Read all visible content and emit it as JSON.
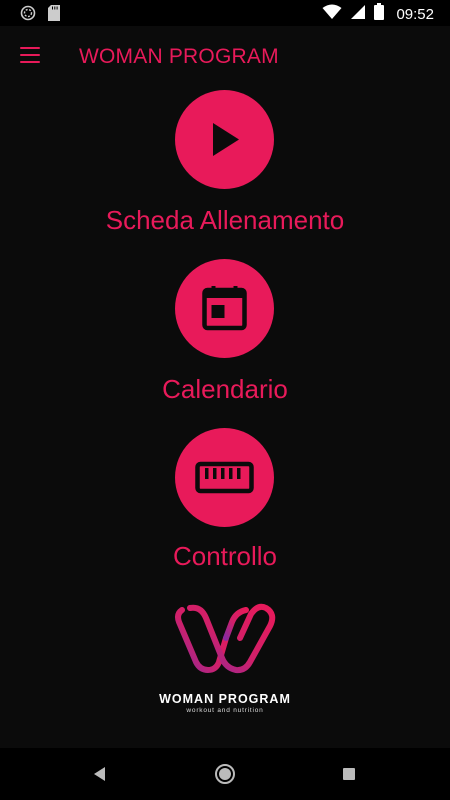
{
  "status_bar": {
    "time": "09:52",
    "icons": [
      "notification-icon",
      "sd-card-icon",
      "wifi-icon",
      "signal-icon",
      "battery-icon"
    ]
  },
  "app_bar": {
    "title": "WOMAN PROGRAM",
    "menu_icon": "hamburger-menu-icon"
  },
  "menu": [
    {
      "label": "Scheda Allenamento",
      "icon": "play-icon"
    },
    {
      "label": "Calendario",
      "icon": "calendar-icon"
    },
    {
      "label": "Controllo",
      "icon": "ruler-icon"
    }
  ],
  "logo": {
    "name": "WOMAN PROGRAM",
    "tagline": "workout and nutrition"
  },
  "nav_bar": {
    "icons": [
      "back-icon",
      "home-icon",
      "recents-icon"
    ]
  },
  "colors": {
    "accent": "#e81a5a",
    "background": "#0b0b0b",
    "logo_gradient_start": "#8a2a9e",
    "logo_gradient_end": "#e81a5a"
  }
}
